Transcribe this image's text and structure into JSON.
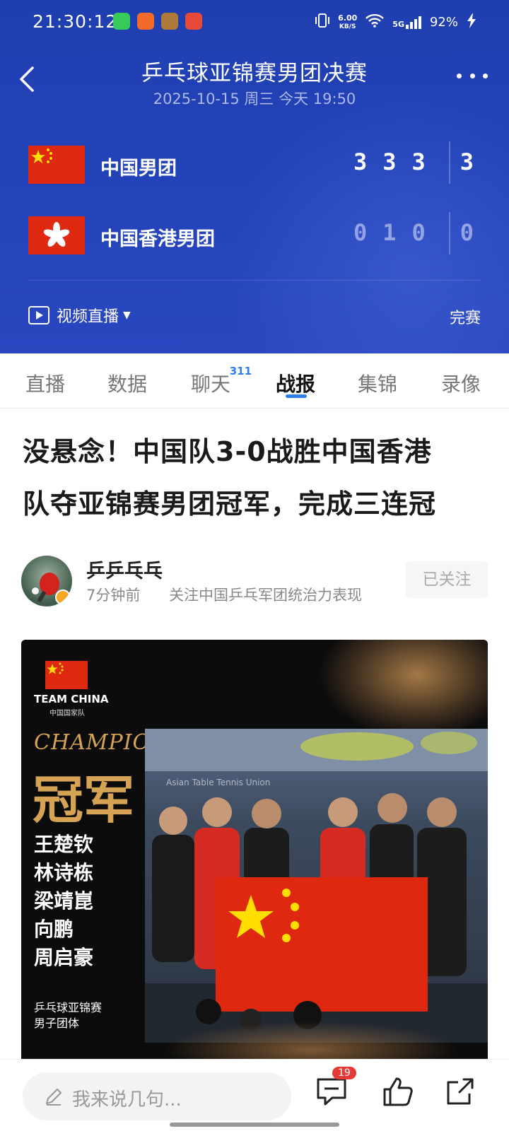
{
  "status_bar": {
    "time": "21:30:12",
    "net_speed_value": "6.00",
    "net_speed_unit": "KB/S",
    "signal": "5G",
    "battery": "92%"
  },
  "header": {
    "title": "乒乓球亚锦赛男团决赛",
    "datetime": "2025-10-15 周三 今天 19:50",
    "teams": [
      {
        "name": "中国男团",
        "games": [
          "3",
          "3",
          "3"
        ],
        "total": "3"
      },
      {
        "name": "中国香港男团",
        "games": [
          "0",
          "1",
          "0"
        ],
        "total": "0"
      }
    ],
    "video_live_label": "视频直播",
    "status_label": "完赛"
  },
  "tabs": [
    {
      "label": "直播"
    },
    {
      "label": "数据"
    },
    {
      "label": "聊天",
      "badge": "311"
    },
    {
      "label": "战报",
      "active": true
    },
    {
      "label": "集锦"
    },
    {
      "label": "录像"
    }
  ],
  "article": {
    "headline_line1": "没悬念！中国队3-0战胜中国香港",
    "headline_line2": "队夺亚锦赛男团冠军，完成三连冠",
    "author": {
      "name": "乒乒乓乓",
      "time": "7分钟前",
      "description": "关注中国乒乓军团统治力表现",
      "follow_label": "已关注"
    },
    "photo": {
      "team_label": "TEAM CHINA",
      "team_sub": "中国国家队",
      "champion_en": "CHAMPION",
      "champion_cn": "冠军",
      "players": [
        "王楚钦",
        "林诗栋",
        "梁靖崑",
        "向鹏",
        "周启豪"
      ],
      "event_line1": "乒乓球亚锦赛",
      "event_line2": "男子团体",
      "banner_text": "Asian Table Tennis Union"
    }
  },
  "bottom_bar": {
    "comment_placeholder": "我来说几句...",
    "comment_count": "19"
  },
  "colors": {
    "header_blue": "#2242b8",
    "accent_blue": "#2f80ed",
    "champion_gold": "#d6a354",
    "china_red": "#de2910"
  }
}
